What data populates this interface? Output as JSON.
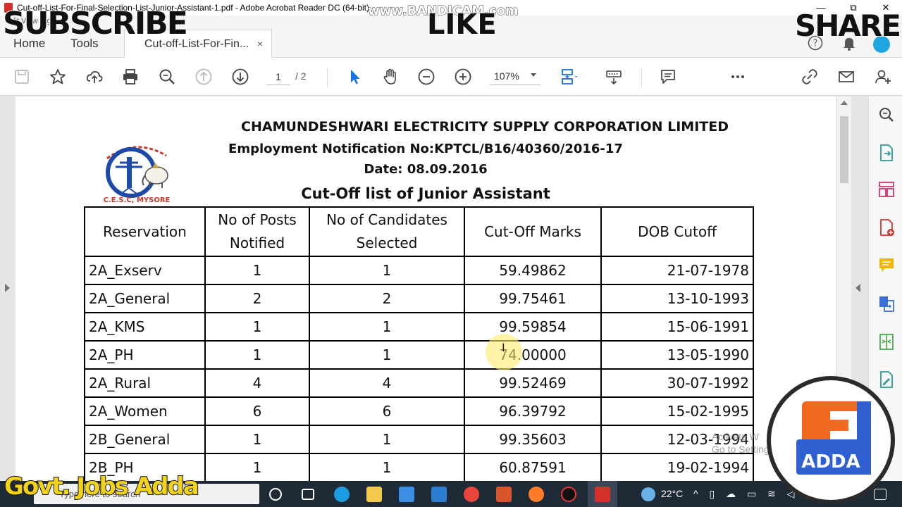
{
  "window": {
    "title": "Cut-off-List-For-Final-Selection-List-Junior-Assistant-1.pdf - Adobe Acrobat Reader DC (64-bit)",
    "menu_hint": "Edit      View      Sign"
  },
  "tabs": {
    "home": "Home",
    "tools": "Tools",
    "document": "Cut-off-List-For-Fin...",
    "close": "×"
  },
  "toolbar": {
    "page_current": "1",
    "page_total": "/ 2",
    "zoom": "107%"
  },
  "document": {
    "org": "CHAMUNDESHWARI ELECTRICITY SUPPLY CORPORATION LIMITED",
    "notification": "Employment Notification No:KPTCL/B16/40360/2016-17",
    "date": "Date: 08.09.2016",
    "list_title": "Cut-Off list of Junior Assistant",
    "logo_text": "C.E.S.C, MYSORE",
    "table": {
      "headers": [
        "Reservation",
        "No of Posts Notified",
        "No of Candidates Selected",
        "Cut-Off Marks",
        "DOB Cutoff"
      ],
      "rows": [
        [
          "2A_Exserv",
          "1",
          "1",
          "59.49862",
          "21-07-1978"
        ],
        [
          "2A_General",
          "2",
          "2",
          "99.75461",
          "13-10-1993"
        ],
        [
          "2A_KMS",
          "1",
          "1",
          "99.59854",
          "15-06-1991"
        ],
        [
          "2A_PH",
          "1",
          "1",
          "74.00000",
          "13-05-1990"
        ],
        [
          "2A_Rural",
          "4",
          "4",
          "99.52469",
          "30-07-1992"
        ],
        [
          "2A_Women",
          "6",
          "6",
          "96.39792",
          "15-02-1995"
        ],
        [
          "2B_General",
          "1",
          "1",
          "99.35603",
          "12-03-1994"
        ],
        [
          "2B_PH",
          "1",
          "1",
          "60.87591",
          "19-02-1994"
        ]
      ]
    },
    "activate_note": "Activate W\nGo to Settings"
  },
  "taskbar": {
    "search": "Type here to search",
    "temperature": "22°C"
  },
  "overlays": {
    "subscribe": "SUBSCRIBE",
    "like": "LIKE",
    "share": "SHARE",
    "bandicam": "www.BANDICAM.com",
    "channel": "Govt. Jobs Adda",
    "adda_logo": "ADDA"
  },
  "colors": {
    "acrobat_red": "#d6302b",
    "toolbar_blue": "#1473e6",
    "taskbar": "#1f2a37",
    "adda_orange": "#f26a21",
    "adda_blue": "#2f5fd0"
  }
}
